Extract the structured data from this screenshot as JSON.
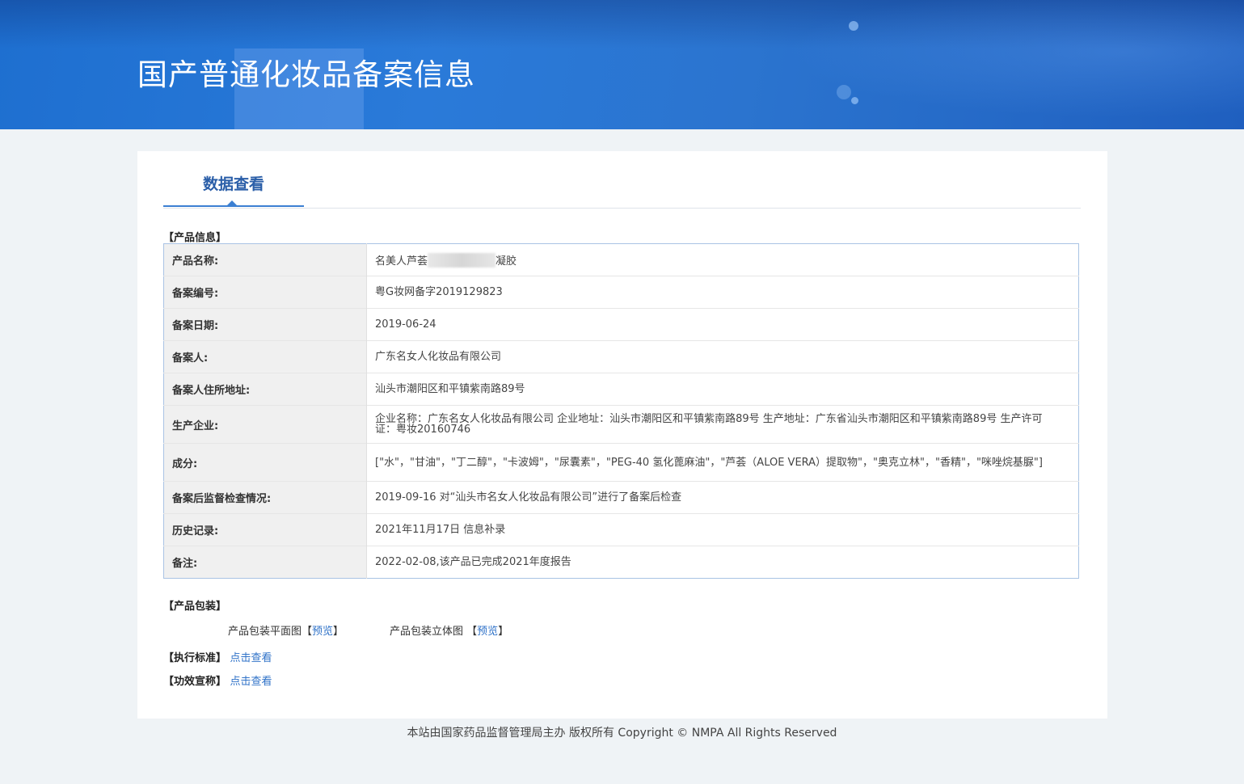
{
  "header": {
    "title": "国产普通化妆品备案信息"
  },
  "tabs": [
    {
      "label": "数据查看",
      "active": true
    }
  ],
  "product_info": {
    "section_label": "【产品信息】",
    "rows": [
      {
        "key": "产品名称:",
        "value_prefix": "名美人芦荟",
        "value_suffix": "凝胶"
      },
      {
        "key": "备案编号:",
        "value": "粤G妆网备字2019129823"
      },
      {
        "key": "备案日期:",
        "value": "2019-06-24"
      },
      {
        "key": "备案人:",
        "value": "广东名女人化妆品有限公司"
      },
      {
        "key": "备案人住所地址:",
        "value": "汕头市潮阳区和平镇紫南路89号"
      },
      {
        "key": "生产企业:",
        "value": "企业名称：广东名女人化妆品有限公司 企业地址：汕头市潮阳区和平镇紫南路89号 生产地址：广东省汕头市潮阳区和平镇紫南路89号 生产许可证：粤妆20160746"
      },
      {
        "key": "成分:",
        "value": "[\"水\"，\"甘油\"，\"丁二醇\"，\"卡波姆\"，\"尿囊素\"，\"PEG-40 氢化蓖麻油\"，\"芦荟（ALOE VERA）提取物\"，\"奥克立林\"，\"香精\"，\"咪唑烷基脲\"]"
      },
      {
        "key": "备案后监督检查情况:",
        "value": "2019-09-16 对“汕头市名女人化妆品有限公司”进行了备案后检查"
      },
      {
        "key": "历史记录:",
        "value": "2021年11月17日 信息补录"
      },
      {
        "key": "备注:",
        "value": "2022-02-08,该产品已完成2021年度报告"
      }
    ]
  },
  "packaging": {
    "section_label": "【产品包装】",
    "flat_label": "产品包装平面图",
    "stereo_label": "产品包装立体图",
    "bracket_open": "【",
    "bracket_close": "】",
    "preview_label": "预览"
  },
  "standard": {
    "label": "【执行标准】",
    "link": "点击查看"
  },
  "efficacy": {
    "label": "【功效宣称】",
    "link": "点击查看"
  },
  "footer": {
    "text": "本站由国家药品监督管理局主办 版权所有 Copyright © NMPA All Rights Reserved"
  },
  "colors": {
    "banner": "#2a7ad9",
    "accent": "#2a5ea8",
    "link": "#2f72c8",
    "table_border": "#a9c3e4",
    "background": "#eff3f6"
  }
}
